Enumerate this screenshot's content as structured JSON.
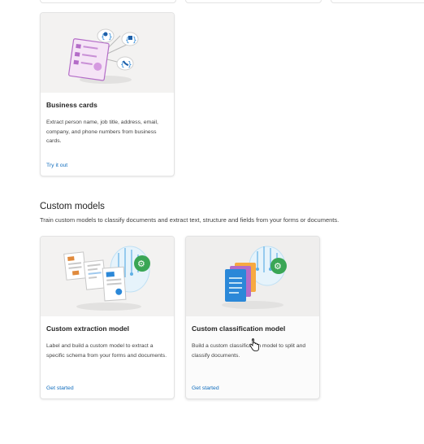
{
  "prebuilt": {
    "business_card": {
      "title": "Business cards",
      "description": "Extract person name, job title, address, email, company, and phone numbers from business cards.",
      "link": "Try it out"
    }
  },
  "custom_section": {
    "title": "Custom models",
    "subtitle": "Train custom models to classify documents and extract text, structure and fields from your forms or documents."
  },
  "custom_cards": [
    {
      "title": "Custom extraction model",
      "description": "Label and build a custom model to extract a specific schema from your forms and documents.",
      "link": "Get started"
    },
    {
      "title": "Custom classification model",
      "description": "Build a custom classification model to split and classify documents.",
      "link": "Get started"
    }
  ],
  "colors": {
    "link": "#0f6cbd",
    "accent_green": "#3aa655",
    "accent_blue": "#2b88d8",
    "accent_purple": "#b46cc8"
  }
}
